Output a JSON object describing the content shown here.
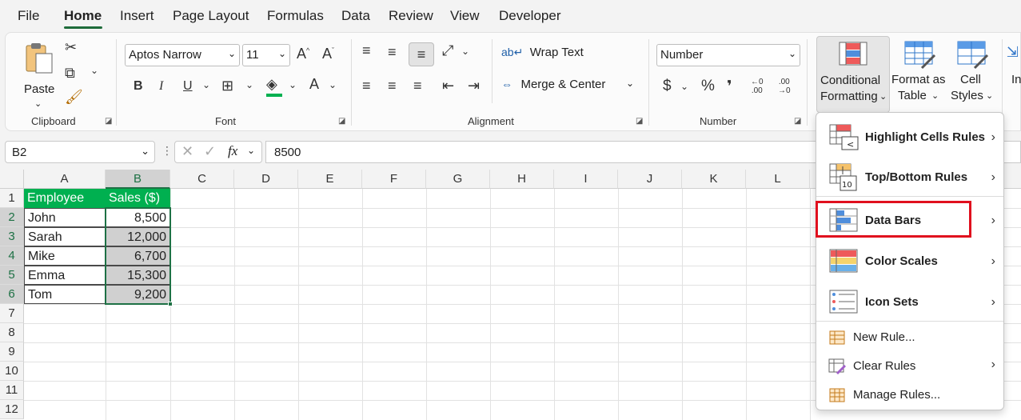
{
  "menu": {
    "items": [
      "File",
      "Home",
      "Insert",
      "Page Layout",
      "Formulas",
      "Data",
      "Review",
      "View",
      "Developer"
    ],
    "active": "Home"
  },
  "ribbon": {
    "clipboard": {
      "paste_label": "Paste",
      "group_label": "Clipboard"
    },
    "font": {
      "font_name": "Aptos Narrow",
      "font_size": "11",
      "group_label": "Font"
    },
    "alignment": {
      "wrap_text": "Wrap Text",
      "merge_center": "Merge & Center",
      "group_label": "Alignment"
    },
    "number": {
      "format": "Number",
      "group_label": "Number",
      "dollar": "$",
      "percent": "%",
      "comma": "❜",
      "inc_dec_1": "←0\n.00",
      "inc_dec_2": ".00\n→0"
    },
    "styles": {
      "conditional_formatting_line1": "Conditional",
      "conditional_formatting_line2": "Formatting",
      "format_as_table_line1": "Format as",
      "format_as_table_line2": "Table",
      "cell_styles_line1": "Cell",
      "cell_styles_line2": "Styles",
      "insert_partial": "In"
    }
  },
  "formula_bar": {
    "name_box": "B2",
    "fx": "fx",
    "value": "8500"
  },
  "sheet": {
    "columns": [
      "A",
      "B",
      "C",
      "D",
      "E",
      "F",
      "G",
      "H",
      "I",
      "J",
      "K",
      "L"
    ],
    "rows": [
      "1",
      "2",
      "3",
      "4",
      "5",
      "6",
      "7",
      "8",
      "9",
      "10",
      "11",
      "12"
    ],
    "table": {
      "headers": [
        "Employee",
        "Sales ($)"
      ],
      "rows": [
        [
          "John",
          "8,500"
        ],
        [
          "Sarah",
          "12,000"
        ],
        [
          "Mike",
          "6,700"
        ],
        [
          "Emma",
          "15,300"
        ],
        [
          "Tom",
          "9,200"
        ]
      ]
    }
  },
  "conditional_formatting_menu": {
    "items": [
      {
        "label": "Highlight Cells Rules",
        "icon": "highlight-cells-icon",
        "submenu": true
      },
      {
        "label": "Top/Bottom Rules",
        "icon": "top-bottom-icon",
        "submenu": true
      },
      {
        "label": "Data Bars",
        "icon": "data-bars-icon",
        "submenu": true,
        "highlighted": true
      },
      {
        "label": "Color Scales",
        "icon": "color-scales-icon",
        "submenu": true
      },
      {
        "label": "Icon Sets",
        "icon": "icon-sets-icon",
        "submenu": true
      },
      {
        "label": "New Rule...",
        "icon": "new-rule-icon",
        "submenu": false
      },
      {
        "label": "Clear Rules",
        "icon": "clear-rules-icon",
        "submenu": true
      },
      {
        "label": "Manage Rules...",
        "icon": "manage-rules-icon",
        "submenu": false
      }
    ],
    "highlight_color": "#e0101e"
  },
  "colors": {
    "accent": "#1e6b3a",
    "header_fill": "#00b050",
    "selection": "#d0d0d0"
  }
}
